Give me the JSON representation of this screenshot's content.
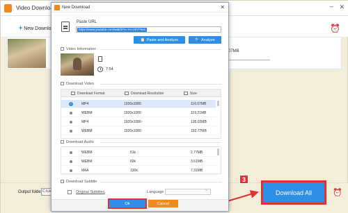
{
  "app": {
    "title": "Video Download",
    "new_download": "New Download",
    "list_item_size": "07MB",
    "output_folder_label": "Output folder:",
    "output_folder_value": "C:\\Use",
    "download_all_label": "Download All"
  },
  "annotation": {
    "step_number": "3"
  },
  "dialog": {
    "title": "New Download",
    "paste_url_label": "Paste URL",
    "url_value": "https://www.youtube.com/watch?v=Ys-O5YF5vs",
    "paste_analyze_label": "Paste and Analyze",
    "analyze_label": "Analyze",
    "video_info_title": "Video Information",
    "duration": "7:54",
    "download_video_title": "Download Video",
    "video_headers": [
      "Download Format",
      "Download Resolution",
      "Size"
    ],
    "video_rows": [
      {
        "format": "MP4",
        "resolution": "1920x1080",
        "size": "116.07MB",
        "selected": true
      },
      {
        "format": "WEBM",
        "resolution": "1920x1080",
        "size": "119.21MB",
        "selected": false
      },
      {
        "format": "MP4",
        "resolution": "1920x1080",
        "size": "135.02MB",
        "selected": false
      },
      {
        "format": "WEBM",
        "resolution": "1920x1080",
        "size": "192.77MB",
        "selected": false
      }
    ],
    "download_audio_title": "Download Audio",
    "audio_rows": [
      {
        "format": "WEBM",
        "bitrate": "51k",
        "size": "2.77MB"
      },
      {
        "format": "WEBM",
        "bitrate": "60k",
        "size": "3.61MB"
      },
      {
        "format": "M4A",
        "bitrate": "130k",
        "size": "7.31MB"
      }
    ],
    "download_subtitle_title": "Download Subtitle",
    "original_subtitles_label": "Original Subtitles",
    "language_label": "Language",
    "language_value": "",
    "ok_label": "Ok",
    "cancel_label": "Cancel"
  },
  "colors": {
    "accent_blue": "#2d8fe6",
    "brand_orange": "#f08a1c",
    "highlight_red": "#e53030",
    "background": "#f4edd9"
  }
}
